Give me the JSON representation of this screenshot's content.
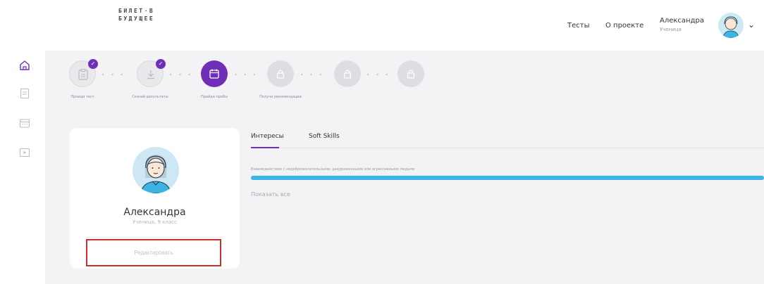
{
  "header": {
    "logo_line1": "БИЛЕТ·В",
    "logo_line2": "БУДУЩЕЕ",
    "nav": [
      "Тесты",
      "О проекте"
    ],
    "user_name": "Александра",
    "user_role": "Ученица"
  },
  "sidebar": {
    "items": [
      {
        "icon": "home-icon",
        "active": true
      },
      {
        "icon": "document-icon",
        "active": false
      },
      {
        "icon": "calendar-icon",
        "active": false
      },
      {
        "icon": "video-icon",
        "active": false
      }
    ]
  },
  "stepper": {
    "steps": [
      {
        "label": "Пройди тест",
        "state": "done",
        "icon": "clipboard-icon"
      },
      {
        "label": "Скачай результаты",
        "state": "done",
        "icon": "download-icon"
      },
      {
        "label": "Пройди пробы",
        "state": "active",
        "icon": "calendar-icon"
      },
      {
        "label": "Получи рекомендации",
        "state": "locked",
        "icon": "lock-icon"
      },
      {
        "label": "",
        "state": "locked",
        "icon": "lock-icon"
      },
      {
        "label": "",
        "state": "locked",
        "icon": "lock-icon"
      }
    ]
  },
  "profile": {
    "name": "Александра",
    "role": "Ученица, 9 класс",
    "edit_label": "Редактировать"
  },
  "tabs": {
    "items": [
      "Интересы",
      "Soft Skills"
    ],
    "active": "Интересы"
  },
  "interests": {
    "items": [
      {
        "text": "Взаимодействие с недоброжелательными, раздраженными или агрессивными людьми",
        "level": 1.0
      }
    ],
    "show_all": "Показать все"
  },
  "colors": {
    "accent": "#6f2db8",
    "bar": "#3cb4e4",
    "highlight": "#c9302c"
  }
}
